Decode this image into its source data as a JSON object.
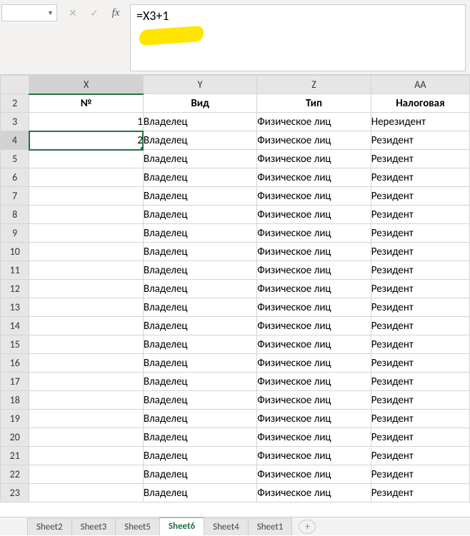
{
  "formula_bar": {
    "name_box": "",
    "cancel_glyph": "✕",
    "accept_glyph": "✓",
    "fx_glyph": "fx",
    "formula": "=X3+1"
  },
  "columns": [
    {
      "id": "X",
      "width": 150,
      "selected": true
    },
    {
      "id": "Y",
      "width": 150,
      "selected": false
    },
    {
      "id": "Z",
      "width": 150,
      "selected": false
    },
    {
      "id": "AA",
      "width": 130,
      "selected": false
    }
  ],
  "header_row_index": 2,
  "headers": {
    "X": "№",
    "Y": "Вид",
    "Z": "Тип",
    "AA": "Налоговая"
  },
  "active_cell": {
    "row": 4,
    "col": "X"
  },
  "rows": [
    {
      "n": 2,
      "X": "№",
      "Y": "Вид",
      "Z": "Тип",
      "AA": "Налоговая"
    },
    {
      "n": 3,
      "X": "1",
      "Y": "Владелец",
      "Z": "Физическое лиц",
      "AA": "Нерезидент"
    },
    {
      "n": 4,
      "X": "2",
      "Y": "Владелец",
      "Z": "Физическое лиц",
      "AA": "Резидент"
    },
    {
      "n": 5,
      "X": "",
      "Y": "Владелец",
      "Z": "Физическое лиц",
      "AA": "Резидент"
    },
    {
      "n": 6,
      "X": "",
      "Y": "Владелец",
      "Z": "Физическое лиц",
      "AA": "Резидент"
    },
    {
      "n": 7,
      "X": "",
      "Y": "Владелец",
      "Z": "Физическое лиц",
      "AA": "Резидент"
    },
    {
      "n": 8,
      "X": "",
      "Y": "Владелец",
      "Z": "Физическое лиц",
      "AA": "Резидент"
    },
    {
      "n": 9,
      "X": "",
      "Y": "Владелец",
      "Z": "Физическое лиц",
      "AA": "Резидент"
    },
    {
      "n": 10,
      "X": "",
      "Y": "Владелец",
      "Z": "Физическое лиц",
      "AA": "Резидент"
    },
    {
      "n": 11,
      "X": "",
      "Y": "Владелец",
      "Z": "Физическое лиц",
      "AA": "Резидент"
    },
    {
      "n": 12,
      "X": "",
      "Y": "Владелец",
      "Z": "Физическое лиц",
      "AA": "Резидент"
    },
    {
      "n": 13,
      "X": "",
      "Y": "Владелец",
      "Z": "Физическое лиц",
      "AA": "Резидент"
    },
    {
      "n": 14,
      "X": "",
      "Y": "Владелец",
      "Z": "Физическое лиц",
      "AA": "Резидент"
    },
    {
      "n": 15,
      "X": "",
      "Y": "Владелец",
      "Z": "Физическое лиц",
      "AA": "Резидент"
    },
    {
      "n": 16,
      "X": "",
      "Y": "Владелец",
      "Z": "Физическое лиц",
      "AA": "Резидент"
    },
    {
      "n": 17,
      "X": "",
      "Y": "Владелец",
      "Z": "Физическое лиц",
      "AA": "Резидент"
    },
    {
      "n": 18,
      "X": "",
      "Y": "Владелец",
      "Z": "Физическое лиц",
      "AA": "Резидент"
    },
    {
      "n": 19,
      "X": "",
      "Y": "Владелец",
      "Z": "Физическое лиц",
      "AA": "Резидент"
    },
    {
      "n": 20,
      "X": "",
      "Y": "Владелец",
      "Z": "Физическое лиц",
      "AA": "Резидент"
    },
    {
      "n": 21,
      "X": "",
      "Y": "Владелец",
      "Z": "Физическое лиц",
      "AA": "Резидент"
    },
    {
      "n": 22,
      "X": "",
      "Y": "Владелец",
      "Z": "Физическое лиц",
      "AA": "Резидент"
    },
    {
      "n": 23,
      "X": "",
      "Y": "Владелец",
      "Z": "Физическое лиц",
      "AA": "Резидент"
    }
  ],
  "tabs": {
    "list": [
      "Sheet2",
      "Sheet3",
      "Sheet5",
      "Sheet6",
      "Sheet4",
      "Sheet1"
    ],
    "active": "Sheet6",
    "add_glyph": "+"
  }
}
